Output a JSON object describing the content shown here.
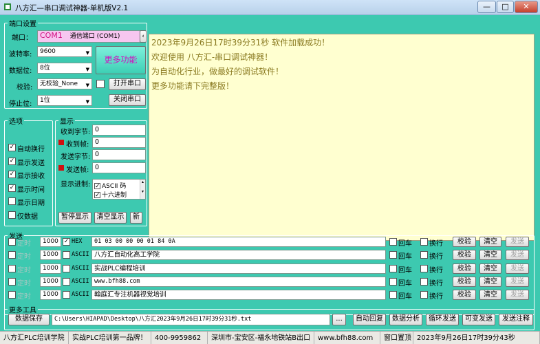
{
  "window": {
    "title": "八方汇—串口调试神器-单机版V2.1",
    "minimize": "—",
    "maximize": "□",
    "close": "✕"
  },
  "port_settings": {
    "legend": "端口设置",
    "port_label": "端口：",
    "port_name": "COM1",
    "port_desc": "通信端口 (COM1)",
    "baud_label": "波特率:",
    "baud_value": "9600",
    "data_bits_label": "数据位:",
    "data_bits_value": "8位",
    "parity_label": "校验:",
    "parity_value": "无校验_None",
    "stop_bits_label": "停止位:",
    "stop_bits_value": "1位",
    "more_features": "更多功能",
    "open_port": "打开串口",
    "close_port": "关闭串口"
  },
  "options": {
    "legend": "选项",
    "items": [
      {
        "label": "自动换行",
        "checked": true
      },
      {
        "label": "显示发送",
        "checked": true
      },
      {
        "label": "显示接收",
        "checked": true
      },
      {
        "label": "显示时间",
        "checked": true
      },
      {
        "label": "显示日期",
        "checked": false
      },
      {
        "label": "仅数据",
        "checked": false
      }
    ]
  },
  "display": {
    "legend": "显示",
    "recv_bytes_label": "收到字节:",
    "recv_bytes": "0",
    "recv_frames_label": "收到帧:",
    "recv_frames": "0",
    "send_bytes_label": "发送字节:",
    "send_bytes": "0",
    "send_frames_label": "发送帧:",
    "send_frames": "0",
    "base_label": "显示进制:",
    "base_options": [
      {
        "label": "ASCII 码",
        "checked": true
      },
      {
        "label": "十六进制",
        "checked": true
      }
    ],
    "pause": "暂停显示",
    "clear": "清空显示",
    "new": "新"
  },
  "receive": {
    "lines": [
      "2023年9月26日17时39分31秒      软件加载成功！",
      "欢迎使用 八方汇-串口调试神器！",
      "为自动化行业，做最好的调试软件！",
      "更多功能请下完整版！"
    ]
  },
  "send": {
    "legend": "发送",
    "timer_label": "定时",
    "newline_label": "回车",
    "wrap_label": "换行",
    "checksum": "校验",
    "clear": "清空",
    "send": "发送",
    "rows": [
      {
        "interval": "1000",
        "mode": "HEX",
        "mode_checked": true,
        "text": "01 03 00 00 00 01 84 0A"
      },
      {
        "interval": "1000",
        "mode": "ASCII",
        "mode_checked": false,
        "text": "八方汇自动化高工学院"
      },
      {
        "interval": "1000",
        "mode": "ASCII",
        "mode_checked": false,
        "text": "实战PLC编程培训"
      },
      {
        "interval": "1000",
        "mode": "ASCII",
        "mode_checked": false,
        "text": "www.bfh88.com"
      },
      {
        "interval": "1000",
        "mode": "ASCII",
        "mode_checked": false,
        "text": "翰庭汇专注机器视觉培训"
      }
    ]
  },
  "more_tools": {
    "legend": "更多工具",
    "save_data": "数据保存",
    "path": "C:\\Users\\HIAPAD\\Desktop\\八方汇2023年9月26日17时39分31秒.txt",
    "browse": "...",
    "auto_reply": "自动回复",
    "data_analysis": "数据分析",
    "loop_send": "循环发送",
    "variable_send": "可变发送",
    "send_comment": "发送注释"
  },
  "statusbar": [
    "八方汇PLC培训学院",
    "实战PLC培训第一品牌！",
    "400-9959862",
    "深圳市-宝安区-福永地铁站B出口",
    "www.bfh88.com",
    "窗口置顶",
    "2023年9月26日17时39分43秒"
  ]
}
